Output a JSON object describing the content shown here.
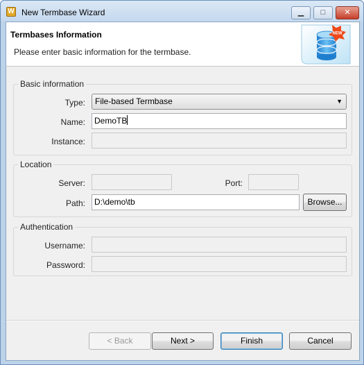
{
  "window": {
    "title": "New Termbase Wizard",
    "icon_glyph": "W",
    "minimize_glyph": "▁",
    "maximize_glyph": "□",
    "close_glyph": "✕"
  },
  "banner": {
    "title": "Termbases Information",
    "subtitle": "Please enter basic information for the termbase.",
    "badge": "NEW"
  },
  "basic": {
    "legend": "Basic information",
    "type_label": "Type:",
    "type_value": "File-based Termbase",
    "name_label": "Name:",
    "name_value": "DemoTB",
    "instance_label": "Instance:",
    "instance_value": ""
  },
  "location": {
    "legend": "Location",
    "server_label": "Server:",
    "server_value": "",
    "port_label": "Port:",
    "port_value": "",
    "path_label": "Path:",
    "path_value": "D:\\demo\\tb",
    "browse_label": "Browse..."
  },
  "auth": {
    "legend": "Authentication",
    "username_label": "Username:",
    "username_value": "",
    "password_label": "Password:",
    "password_value": ""
  },
  "footer": {
    "back_label": "< Back",
    "next_label": "Next >",
    "finish_label": "Finish",
    "cancel_label": "Cancel"
  },
  "colors": {
    "titlebar": "#c4d8ee",
    "client_bg": "#f0f0f0",
    "default_button_border": "#3c7fb1"
  }
}
